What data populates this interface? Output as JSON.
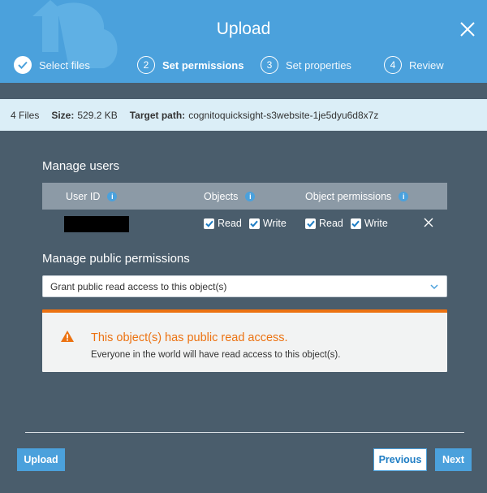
{
  "dialog": {
    "title": "Upload"
  },
  "steps": [
    {
      "number": "1",
      "label": "Select files",
      "state": "done"
    },
    {
      "number": "2",
      "label": "Set permissions",
      "state": "active"
    },
    {
      "number": "3",
      "label": "Set properties",
      "state": "pending"
    },
    {
      "number": "4",
      "label": "Review",
      "state": "pending"
    }
  ],
  "info": {
    "files": "4 Files",
    "size_label": "Size:",
    "size_value": "529.2 KB",
    "path_label": "Target path:",
    "path_value": "cognitoquicksight-s3website-1je5dyu6d8x7z"
  },
  "manage_users": {
    "heading": "Manage users",
    "columns": {
      "user_id": "User ID",
      "objects": "Objects",
      "object_permissions": "Object permissions"
    },
    "rows": [
      {
        "objects_read": "Read",
        "objects_write": "Write",
        "perm_read": "Read",
        "perm_write": "Write"
      }
    ]
  },
  "public_permissions": {
    "heading": "Manage public permissions",
    "selected": "Grant public read access to this object(s)"
  },
  "warning": {
    "title": "This object(s) has public read access.",
    "text": "Everyone in the world will have read access to this object(s)."
  },
  "footer": {
    "upload": "Upload",
    "previous": "Previous",
    "next": "Next"
  },
  "colors": {
    "header": "#4ba1dc",
    "body": "#4a5d6c",
    "warning": "#ec7211",
    "infobar": "#dbeef7"
  }
}
